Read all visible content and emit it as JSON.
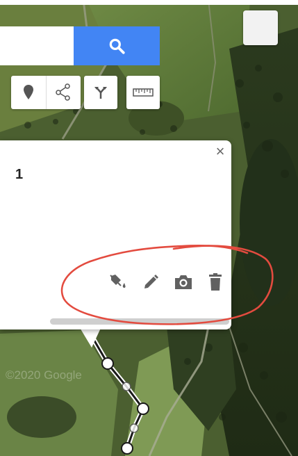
{
  "map": {
    "watermark": "©2020 Google"
  },
  "search": {
    "value": "",
    "button_icon": "search-icon"
  },
  "toolbar": {
    "tools": [
      {
        "name": "marker-icon"
      },
      {
        "name": "draw-line-icon"
      },
      {
        "name": "directions-icon"
      },
      {
        "name": "ruler-icon"
      }
    ]
  },
  "popup": {
    "title": "1",
    "close_label": "×",
    "actions": [
      {
        "name": "style-paint-icon"
      },
      {
        "name": "edit-pencil-icon"
      },
      {
        "name": "camera-icon"
      },
      {
        "name": "delete-trash-icon"
      }
    ]
  },
  "colors": {
    "search_button": "#4285f4",
    "annotation": "#e34b3f",
    "route_line": "#1a1a1a"
  }
}
